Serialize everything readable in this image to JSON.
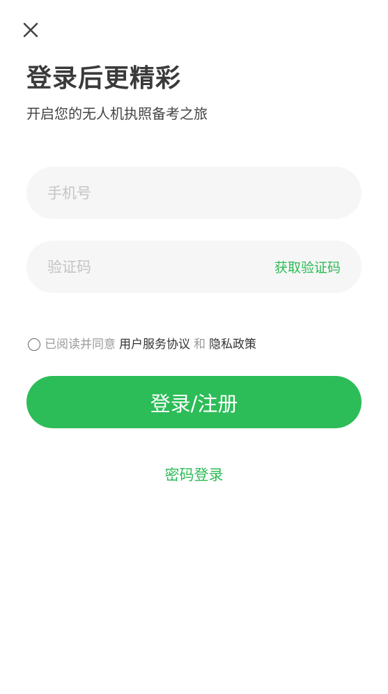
{
  "header": {
    "close_icon": "close-icon",
    "title": "登录后更精彩",
    "subtitle": "开启您的无人机执照备考之旅"
  },
  "form": {
    "phone_placeholder": "手机号",
    "phone_value": "",
    "code_placeholder": "验证码",
    "code_value": "",
    "get_code_label": "获取验证码"
  },
  "agreement": {
    "checked": false,
    "prefix": "已阅读并同意",
    "service_link": "用户服务协议",
    "and": "和",
    "privacy_link": "隐私政策"
  },
  "actions": {
    "submit_label": "登录/注册",
    "password_login_label": "密码登录"
  },
  "colors": {
    "accent": "#2dbd58",
    "title": "#3a3a3a",
    "field_bg": "#f6f6f6",
    "placeholder": "#c4c4c4"
  }
}
